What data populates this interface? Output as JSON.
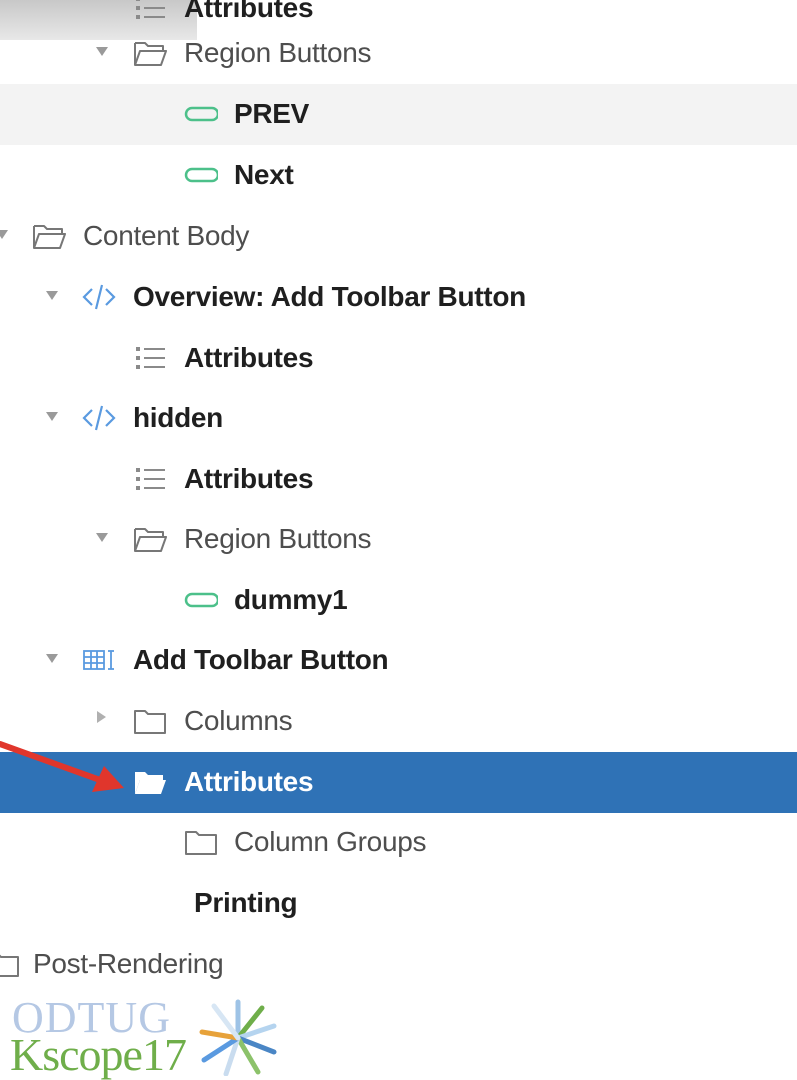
{
  "tree": {
    "rows": [
      {
        "label": "Attributes"
      },
      {
        "label": "Region Buttons"
      },
      {
        "label": "PREV"
      },
      {
        "label": "Next"
      },
      {
        "label": "Content Body"
      },
      {
        "label": "Overview: Add Toolbar Button"
      },
      {
        "label": "Attributes"
      },
      {
        "label": "hidden"
      },
      {
        "label": "Attributes"
      },
      {
        "label": "Region Buttons"
      },
      {
        "label": "dummy1"
      },
      {
        "label": "Add Toolbar Button"
      },
      {
        "label": "Columns"
      },
      {
        "label": "Attributes"
      },
      {
        "label": "Column Groups"
      },
      {
        "label": "Printing"
      },
      {
        "label": "Post-Rendering"
      }
    ]
  },
  "logo": {
    "line1": "ODTUG",
    "line2": "Kscope17"
  },
  "colors": {
    "selection": "#2f72b6",
    "button_icon": "#4cc08a",
    "region_icon": "#5a9ae0",
    "arrow": "#e0362c"
  },
  "icons": {
    "folder": "folder-icon",
    "folder_open": "folder-open-icon",
    "button": "button-pill-icon",
    "attributes": "list-icon",
    "static_region": "code-icon",
    "report_region": "grid-icon"
  }
}
